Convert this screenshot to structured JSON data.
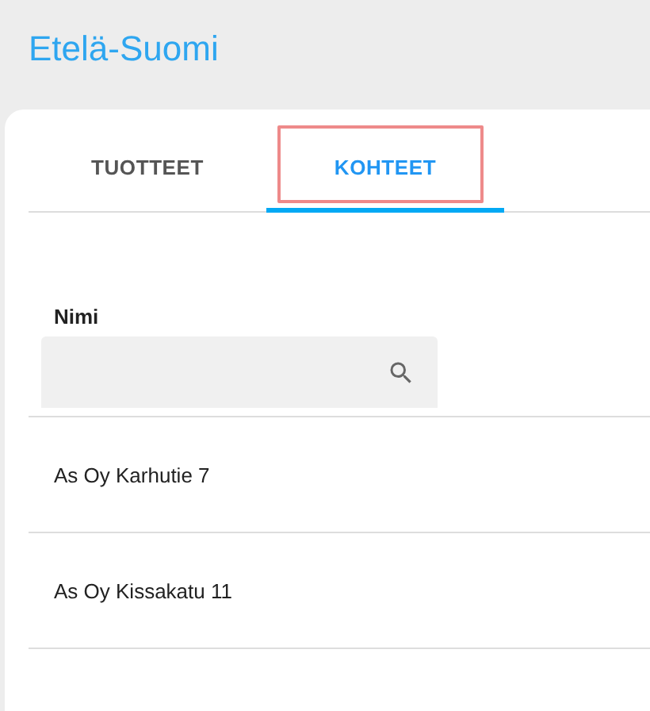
{
  "title": "Etelä-Suomi",
  "tabs": [
    {
      "label": "TUOTTEET",
      "selected": false,
      "highlighted": false
    },
    {
      "label": "KOHTEET",
      "selected": true,
      "highlighted": true
    }
  ],
  "filter": {
    "label": "Nimi"
  },
  "rows": [
    "As Oy Karhutie 7",
    "As Oy Kissakatu 11"
  ]
}
